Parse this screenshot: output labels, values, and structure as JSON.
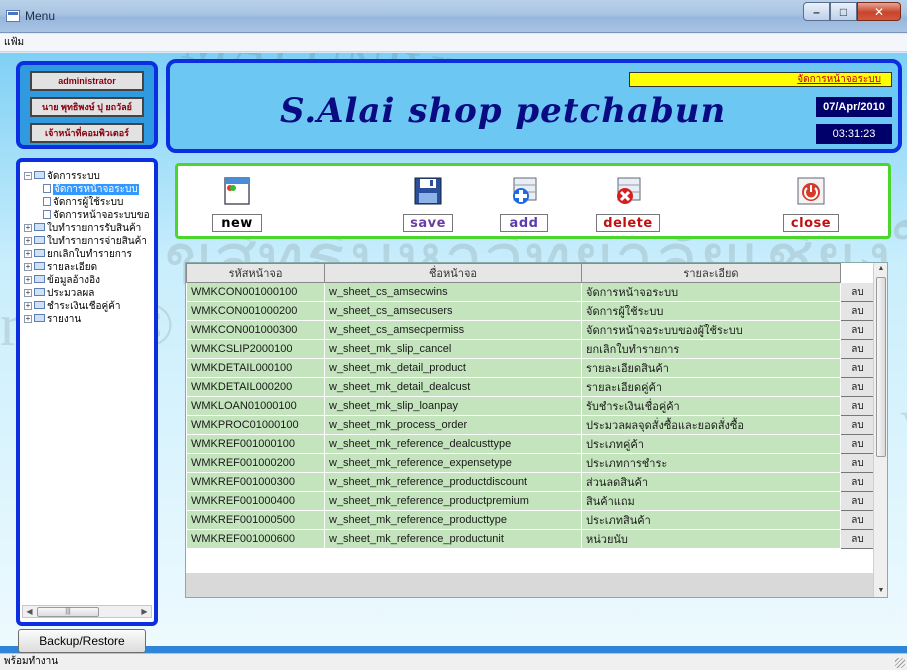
{
  "window": {
    "title": "Menu",
    "icon": "app-window-icon"
  },
  "menubar": {
    "file_label": "แฟ้ม"
  },
  "user": {
    "role": "administrator",
    "name": "นาย พุทธิพงษ์ ปุ ยถวัลย์",
    "position": "เจ้าหน้าที่คอมพิวเตอร์"
  },
  "header": {
    "shop_name": "S.Alai shop petchabun",
    "screen_label": "จัดการหน้าจอระบบ",
    "date": "07/Apr/2010",
    "time": "03:31:23"
  },
  "tree": [
    {
      "label": "จัดการระบบ",
      "expanded": true,
      "children": [
        {
          "label": "จัดการหน้าจอระบบ",
          "selected": true
        },
        {
          "label": "จัดการผู้ใช้ระบบ",
          "selected": false
        },
        {
          "label": "จัดการหน้าจอระบบของผู้ใช้ระบบ",
          "selected": false
        }
      ]
    },
    {
      "label": "ใบทำรายการรับสินค้า"
    },
    {
      "label": "ใบทำรายการจ่ายสินค้า"
    },
    {
      "label": "ยกเลิกใบทำรายการ"
    },
    {
      "label": "รายละเอียด"
    },
    {
      "label": "ข้อมูลอ้างอิง"
    },
    {
      "label": "ประมวลผล"
    },
    {
      "label": "ชำระเงินเชื่อคู่ค้า"
    },
    {
      "label": "รายงาน"
    }
  ],
  "toolbar": {
    "new_label": "new",
    "save_label": "save",
    "add_label": "add",
    "delete_label": "delete",
    "close_label": "close"
  },
  "grid": {
    "headers": [
      "รหัสหน้าจอ",
      "ชื่อหน้าจอ",
      "รายละเอียด"
    ],
    "delete_label": "ลบ",
    "rows": [
      [
        "WMKCON001000100",
        "w_sheet_cs_amsecwins",
        "จัดการหน้าจอระบบ"
      ],
      [
        "WMKCON001000200",
        "w_sheet_cs_amsecusers",
        "จัดการผู้ใช้ระบบ"
      ],
      [
        "WMKCON001000300",
        "w_sheet_cs_amsecpermiss",
        "จัดการหน้าจอระบบของผู้ใช้ระบบ"
      ],
      [
        "WMKCSLIP2000100",
        "w_sheet_mk_slip_cancel",
        "ยกเลิกใบทำรายการ"
      ],
      [
        "WMKDETAIL000100",
        "w_sheet_mk_detail_product",
        "รายละเอียดสินค้า"
      ],
      [
        "WMKDETAIL000200",
        "w_sheet_mk_detail_dealcust",
        "รายละเอียดคู่ค้า"
      ],
      [
        "WMKLOAN01000100",
        "w_sheet_mk_slip_loanpay",
        "รับชำระเงินเชื่อคู่ค้า"
      ],
      [
        "WMKPROC01000100",
        "w_sheet_mk_process_order",
        "ประมวลผลจุดสั่งซื้อและยอดสั่งซื้อ"
      ],
      [
        "WMKREF001000100",
        "w_sheet_mk_reference_dealcusttype",
        "ประเภทคู่ค้า"
      ],
      [
        "WMKREF001000200",
        "w_sheet_mk_reference_expensetype",
        "ประเภทการชำระ"
      ],
      [
        "WMKREF001000300",
        "w_sheet_mk_reference_productdiscount",
        "ส่วนลดสินค้า"
      ],
      [
        "WMKREF001000400",
        "w_sheet_mk_reference_productpremium",
        "สินค้าแถม"
      ],
      [
        "WMKREF001000500",
        "w_sheet_mk_reference_producttype",
        "ประเภทสินค้า"
      ],
      [
        "WMKREF001000600",
        "w_sheet_mk_reference_productunit",
        "หน่วยนับ"
      ]
    ]
  },
  "backup_label": "Backup/Restore",
  "status_text": "พร้อมทำงาน",
  "colors": {
    "panel_border": "#0a2ee0",
    "toolbar_border": "#4cd62d",
    "grid_cell": "#c4e4bd",
    "label_bg": "#ffff00"
  }
}
